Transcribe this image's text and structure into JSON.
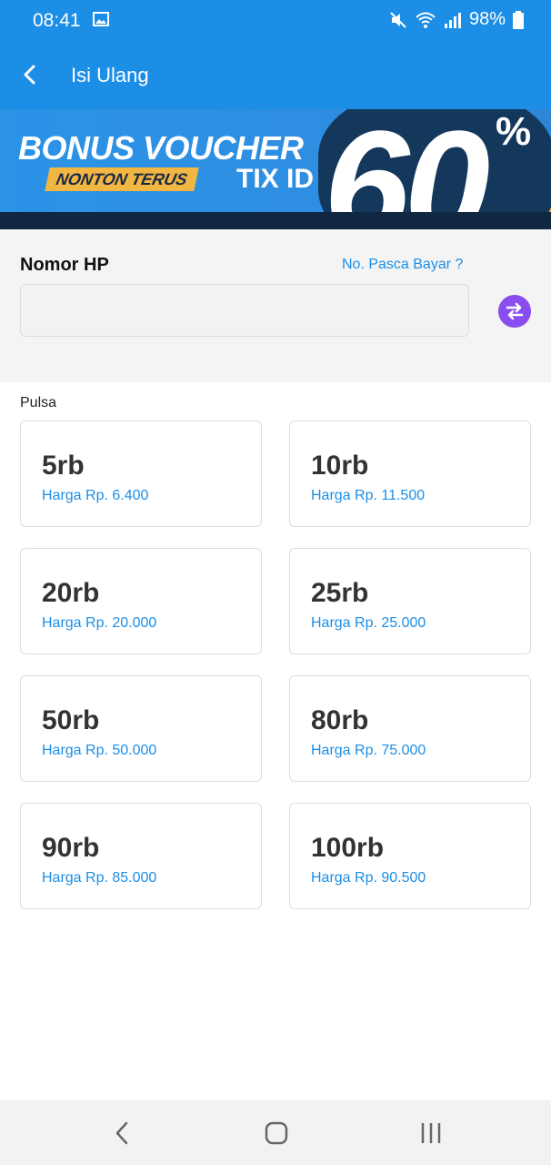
{
  "status_bar": {
    "time": "08:41",
    "battery": "98%",
    "icons": [
      "image-icon",
      "mute-icon",
      "wifi-icon",
      "signal-icon",
      "battery-icon"
    ]
  },
  "app_bar": {
    "title": "Isi Ulang",
    "back_icon": "back-arrow-icon"
  },
  "banner": {
    "headline": "BONUS VOUCHER",
    "tagline": "NONTON TERUS",
    "brand": "TIX ID",
    "big_number": "60",
    "percent": "%"
  },
  "phone": {
    "label": "Nomor HP",
    "postpaid_link": "No. Pasca Bayar ?",
    "input_value": "",
    "input_placeholder": "",
    "swap_icon": "swap-arrows-icon"
  },
  "pulsa": {
    "label": "Pulsa",
    "items": [
      {
        "amount": "5rb",
        "price": "Harga Rp. 6.400"
      },
      {
        "amount": "10rb",
        "price": "Harga Rp. 11.500"
      },
      {
        "amount": "20rb",
        "price": "Harga Rp. 20.000"
      },
      {
        "amount": "25rb",
        "price": "Harga Rp. 25.000"
      },
      {
        "amount": "50rb",
        "price": "Harga Rp. 50.000"
      },
      {
        "amount": "80rb",
        "price": "Harga Rp. 75.000"
      },
      {
        "amount": "90rb",
        "price": "Harga Rp. 85.000"
      },
      {
        "amount": "100rb",
        "price": "Harga Rp. 90.500"
      }
    ]
  },
  "nav_bar": {
    "icons": [
      "nav-back-icon",
      "nav-home-icon",
      "nav-recents-icon"
    ]
  },
  "colors": {
    "primary": "#1c8ee6",
    "accent_purple": "#8a4df0",
    "banner_gold": "#f0a843",
    "banner_dark": "#14375c"
  }
}
